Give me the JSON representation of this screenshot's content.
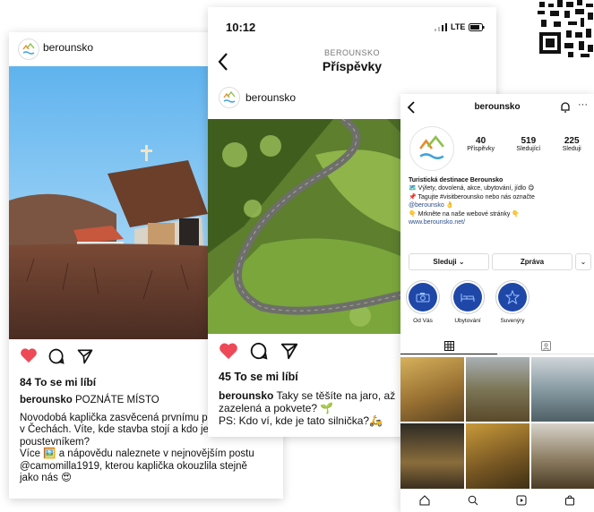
{
  "qr": {
    "icon": "qr-code-icon"
  },
  "post1": {
    "username": "berounsko",
    "likes": "84 To se mi líbí",
    "caption_user": "berounsko",
    "caption_head": " POZNÁTE MÍSTO",
    "caption_lines": [
      "Novodobá kaplička zasvěcená prvnímu p",
      "v Čechách. Víte, kde stavba stojí a kdo je",
      "poustevníkem?",
      "Více 🖼️ a nápovědu naleznete v nejnovějším postu",
      "@camomilla1919, kterou kaplička okouzlila stejně",
      "jako nás 😍"
    ],
    "mention": "@camomilla1919"
  },
  "post2": {
    "time": "10:12",
    "signal": "LTE",
    "account": "BEROUNSKO",
    "title": "Příspěvky",
    "username": "berounsko",
    "likes": "45 To se mi líbí",
    "caption_user": "berounsko",
    "caption_lines": [
      " Taky se těšíte na jaro, až",
      "zazelená a pokvete? 🌱",
      "PS: Kdo ví, kde je tato silnička?🛵"
    ]
  },
  "profile": {
    "username": "berounsko",
    "stats": [
      {
        "value": "40",
        "label": "Příspěvky"
      },
      {
        "value": "519",
        "label": "Sledující"
      },
      {
        "value": "225",
        "label": "Sleduji"
      }
    ],
    "bio_name": "Turistická destinace Berounsko",
    "bio_lines": [
      "🗺️ Výlety, dovolená, akce, ubytování, jídlo 😋",
      "📌 Tagujte #visitberounsko nebo nás označte",
      "@berounsko 👌",
      "👇 Mrkněte na naše webové stránky 👇",
      "www.berounsko.net/"
    ],
    "follow_label": "Sleduji ⌄",
    "message_label": "Zpráva",
    "more_label": "⌄",
    "highlights": [
      {
        "label": "Od Vás",
        "icon": "camera-icon"
      },
      {
        "label": "Ubytování",
        "icon": "bed-icon"
      },
      {
        "label": "Suvenýry",
        "icon": "star-icon"
      }
    ],
    "colors": {
      "highlight": "#1e47a8",
      "link": "#2b4f8a",
      "accent": "#d6336c"
    }
  }
}
